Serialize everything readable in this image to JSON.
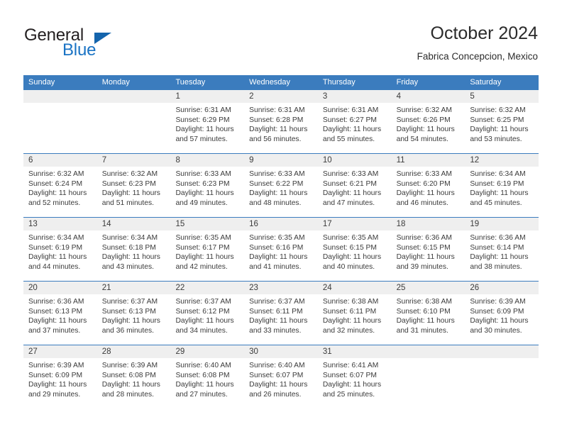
{
  "brand": {
    "name_part1": "General",
    "name_part2": "Blue",
    "triangle_color": "#1464ac",
    "blue_text_color": "#1a73c4"
  },
  "header": {
    "title": "October 2024",
    "subtitle": "Fabrica Concepcion, Mexico"
  },
  "theme": {
    "header_blue": "#3b7cbe",
    "day_strip_gray": "#efefef",
    "text_color": "#3b3b3b"
  },
  "weekdays": [
    "Sunday",
    "Monday",
    "Tuesday",
    "Wednesday",
    "Thursday",
    "Friday",
    "Saturday"
  ],
  "weeks": [
    [
      {
        "day": "",
        "sunrise": "",
        "sunset": "",
        "daylight": ""
      },
      {
        "day": "",
        "sunrise": "",
        "sunset": "",
        "daylight": ""
      },
      {
        "day": "1",
        "sunrise": "Sunrise: 6:31 AM",
        "sunset": "Sunset: 6:29 PM",
        "daylight": "Daylight: 11 hours and 57 minutes."
      },
      {
        "day": "2",
        "sunrise": "Sunrise: 6:31 AM",
        "sunset": "Sunset: 6:28 PM",
        "daylight": "Daylight: 11 hours and 56 minutes."
      },
      {
        "day": "3",
        "sunrise": "Sunrise: 6:31 AM",
        "sunset": "Sunset: 6:27 PM",
        "daylight": "Daylight: 11 hours and 55 minutes."
      },
      {
        "day": "4",
        "sunrise": "Sunrise: 6:32 AM",
        "sunset": "Sunset: 6:26 PM",
        "daylight": "Daylight: 11 hours and 54 minutes."
      },
      {
        "day": "5",
        "sunrise": "Sunrise: 6:32 AM",
        "sunset": "Sunset: 6:25 PM",
        "daylight": "Daylight: 11 hours and 53 minutes."
      }
    ],
    [
      {
        "day": "6",
        "sunrise": "Sunrise: 6:32 AM",
        "sunset": "Sunset: 6:24 PM",
        "daylight": "Daylight: 11 hours and 52 minutes."
      },
      {
        "day": "7",
        "sunrise": "Sunrise: 6:32 AM",
        "sunset": "Sunset: 6:23 PM",
        "daylight": "Daylight: 11 hours and 51 minutes."
      },
      {
        "day": "8",
        "sunrise": "Sunrise: 6:33 AM",
        "sunset": "Sunset: 6:23 PM",
        "daylight": "Daylight: 11 hours and 49 minutes."
      },
      {
        "day": "9",
        "sunrise": "Sunrise: 6:33 AM",
        "sunset": "Sunset: 6:22 PM",
        "daylight": "Daylight: 11 hours and 48 minutes."
      },
      {
        "day": "10",
        "sunrise": "Sunrise: 6:33 AM",
        "sunset": "Sunset: 6:21 PM",
        "daylight": "Daylight: 11 hours and 47 minutes."
      },
      {
        "day": "11",
        "sunrise": "Sunrise: 6:33 AM",
        "sunset": "Sunset: 6:20 PM",
        "daylight": "Daylight: 11 hours and 46 minutes."
      },
      {
        "day": "12",
        "sunrise": "Sunrise: 6:34 AM",
        "sunset": "Sunset: 6:19 PM",
        "daylight": "Daylight: 11 hours and 45 minutes."
      }
    ],
    [
      {
        "day": "13",
        "sunrise": "Sunrise: 6:34 AM",
        "sunset": "Sunset: 6:19 PM",
        "daylight": "Daylight: 11 hours and 44 minutes."
      },
      {
        "day": "14",
        "sunrise": "Sunrise: 6:34 AM",
        "sunset": "Sunset: 6:18 PM",
        "daylight": "Daylight: 11 hours and 43 minutes."
      },
      {
        "day": "15",
        "sunrise": "Sunrise: 6:35 AM",
        "sunset": "Sunset: 6:17 PM",
        "daylight": "Daylight: 11 hours and 42 minutes."
      },
      {
        "day": "16",
        "sunrise": "Sunrise: 6:35 AM",
        "sunset": "Sunset: 6:16 PM",
        "daylight": "Daylight: 11 hours and 41 minutes."
      },
      {
        "day": "17",
        "sunrise": "Sunrise: 6:35 AM",
        "sunset": "Sunset: 6:15 PM",
        "daylight": "Daylight: 11 hours and 40 minutes."
      },
      {
        "day": "18",
        "sunrise": "Sunrise: 6:36 AM",
        "sunset": "Sunset: 6:15 PM",
        "daylight": "Daylight: 11 hours and 39 minutes."
      },
      {
        "day": "19",
        "sunrise": "Sunrise: 6:36 AM",
        "sunset": "Sunset: 6:14 PM",
        "daylight": "Daylight: 11 hours and 38 minutes."
      }
    ],
    [
      {
        "day": "20",
        "sunrise": "Sunrise: 6:36 AM",
        "sunset": "Sunset: 6:13 PM",
        "daylight": "Daylight: 11 hours and 37 minutes."
      },
      {
        "day": "21",
        "sunrise": "Sunrise: 6:37 AM",
        "sunset": "Sunset: 6:13 PM",
        "daylight": "Daylight: 11 hours and 36 minutes."
      },
      {
        "day": "22",
        "sunrise": "Sunrise: 6:37 AM",
        "sunset": "Sunset: 6:12 PM",
        "daylight": "Daylight: 11 hours and 34 minutes."
      },
      {
        "day": "23",
        "sunrise": "Sunrise: 6:37 AM",
        "sunset": "Sunset: 6:11 PM",
        "daylight": "Daylight: 11 hours and 33 minutes."
      },
      {
        "day": "24",
        "sunrise": "Sunrise: 6:38 AM",
        "sunset": "Sunset: 6:11 PM",
        "daylight": "Daylight: 11 hours and 32 minutes."
      },
      {
        "day": "25",
        "sunrise": "Sunrise: 6:38 AM",
        "sunset": "Sunset: 6:10 PM",
        "daylight": "Daylight: 11 hours and 31 minutes."
      },
      {
        "day": "26",
        "sunrise": "Sunrise: 6:39 AM",
        "sunset": "Sunset: 6:09 PM",
        "daylight": "Daylight: 11 hours and 30 minutes."
      }
    ],
    [
      {
        "day": "27",
        "sunrise": "Sunrise: 6:39 AM",
        "sunset": "Sunset: 6:09 PM",
        "daylight": "Daylight: 11 hours and 29 minutes."
      },
      {
        "day": "28",
        "sunrise": "Sunrise: 6:39 AM",
        "sunset": "Sunset: 6:08 PM",
        "daylight": "Daylight: 11 hours and 28 minutes."
      },
      {
        "day": "29",
        "sunrise": "Sunrise: 6:40 AM",
        "sunset": "Sunset: 6:08 PM",
        "daylight": "Daylight: 11 hours and 27 minutes."
      },
      {
        "day": "30",
        "sunrise": "Sunrise: 6:40 AM",
        "sunset": "Sunset: 6:07 PM",
        "daylight": "Daylight: 11 hours and 26 minutes."
      },
      {
        "day": "31",
        "sunrise": "Sunrise: 6:41 AM",
        "sunset": "Sunset: 6:07 PM",
        "daylight": "Daylight: 11 hours and 25 minutes."
      },
      {
        "day": "",
        "sunrise": "",
        "sunset": "",
        "daylight": ""
      },
      {
        "day": "",
        "sunrise": "",
        "sunset": "",
        "daylight": ""
      }
    ]
  ]
}
